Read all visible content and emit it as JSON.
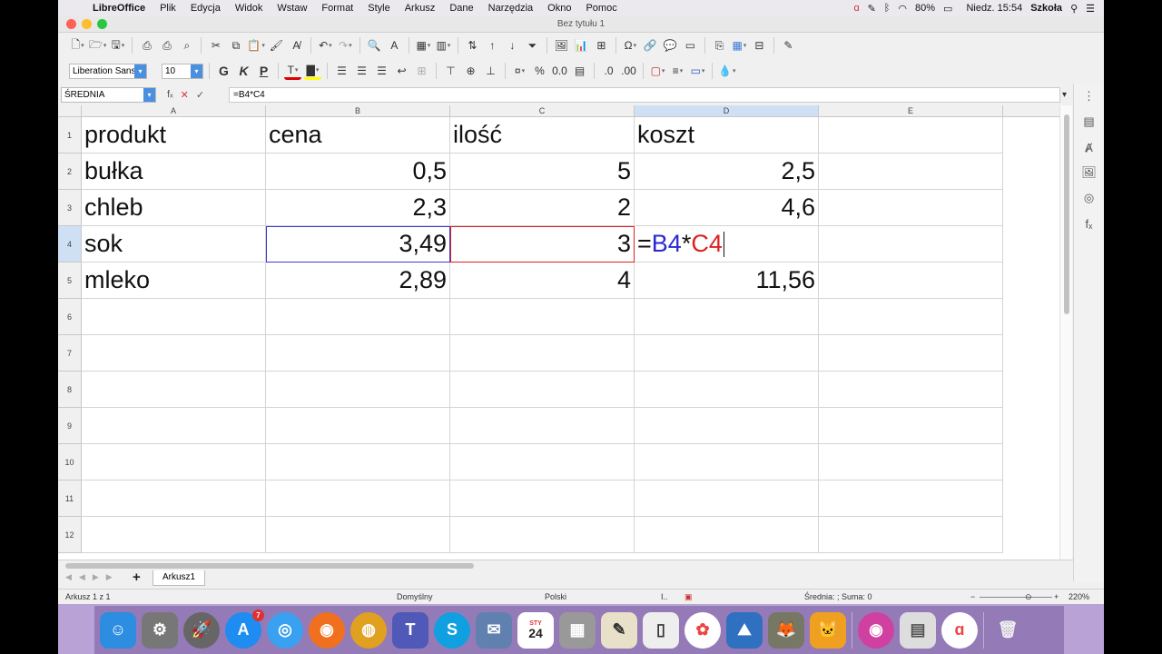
{
  "menubar": {
    "app": "LibreOffice",
    "items": [
      "Plik",
      "Edycja",
      "Widok",
      "Wstaw",
      "Format",
      "Style",
      "Arkusz",
      "Dane",
      "Narzędzia",
      "Okno",
      "Pomoc"
    ],
    "battery": "80%",
    "clock": "Niedz. 15:54",
    "user": "Szkoła"
  },
  "window": {
    "title": "Bez tytułu 1"
  },
  "format": {
    "font_name": "Liberation Sans",
    "font_size": "10"
  },
  "formula": {
    "name_box": "ŚREDNIA",
    "fx_label": "fₓ",
    "content": "=B4*C4"
  },
  "columns": [
    "A",
    "B",
    "C",
    "D",
    "E"
  ],
  "rows": [
    "1",
    "2",
    "3",
    "4",
    "5",
    "6",
    "7",
    "8",
    "9",
    "10",
    "11",
    "12"
  ],
  "cells": {
    "r1": {
      "a": "produkt",
      "b": "cena",
      "c": "ilość",
      "d": "koszt"
    },
    "r2": {
      "a": "bułka",
      "b": "0,5",
      "c": "5",
      "d": "2,5"
    },
    "r3": {
      "a": "chleb",
      "b": "2,3",
      "c": "2",
      "d": "4,6"
    },
    "r4": {
      "a": "sok",
      "b": "3,49",
      "c": "3",
      "d_eq": "=",
      "d_ref1": "B4",
      "d_op": "*",
      "d_ref2": "C4"
    },
    "r5": {
      "a": "mleko",
      "b": "2,89",
      "c": "4",
      "d": "11,56"
    }
  },
  "sheet_tab": "Arkusz1",
  "status": {
    "sheet": "Arkusz 1 z 1",
    "style": "Domyślny",
    "language": "Polski",
    "summary": "Średnia: ; Suma: 0",
    "zoom": "220%"
  },
  "dock": {
    "calendar_month": "STY",
    "calendar_day": "24",
    "appstore_badge": "7"
  },
  "colors": {
    "ref_b": "#2a2ad0",
    "ref_c": "#e02020",
    "selected_header": "#cfe0f5"
  }
}
